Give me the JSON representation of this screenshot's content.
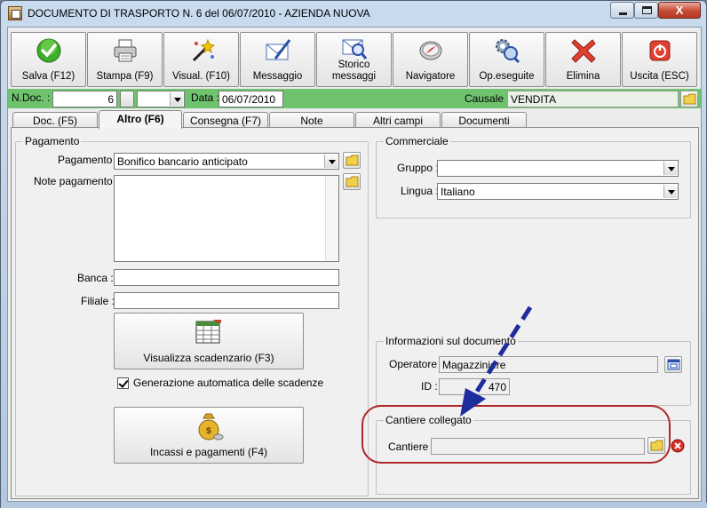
{
  "window": {
    "title": "DOCUMENTO DI TRASPORTO N. 6  del 06/07/2010 - AZIENDA NUOVA",
    "close_glyph": "X"
  },
  "toolbar": [
    {
      "label": "Salva (F12)",
      "icon": "check-icon"
    },
    {
      "label": "Stampa (F9)",
      "icon": "printer-icon"
    },
    {
      "label": "Visual. (F10)",
      "icon": "magic-wand-icon"
    },
    {
      "label": "Messaggio",
      "icon": "envelope-pen-icon"
    },
    {
      "label": "Storico messaggi",
      "icon": "message-history-icon"
    },
    {
      "label": "Navigatore",
      "icon": "compass-icon"
    },
    {
      "label": "Op.eseguite",
      "icon": "gears-search-icon"
    },
    {
      "label": "Elimina",
      "icon": "red-x-icon"
    },
    {
      "label": "Uscita (ESC)",
      "icon": "exit-icon"
    }
  ],
  "header": {
    "ndoc_label": "N.Doc. :",
    "ndoc_value": "6",
    "data_label": "Data :",
    "data_value": "06/07/2010",
    "causale_label": "Causale :",
    "causale_value": "VENDITA"
  },
  "tabs": [
    {
      "label": "Doc. (F5)",
      "active": false
    },
    {
      "label": "Altro (F6)",
      "active": true
    },
    {
      "label": "Consegna (F7)",
      "active": false
    },
    {
      "label": "Note",
      "active": false
    },
    {
      "label": "Altri campi",
      "active": false
    },
    {
      "label": "Documenti",
      "active": false
    }
  ],
  "pagamento": {
    "group_title": "Pagamento",
    "pagamento_label": "Pagamento :",
    "pagamento_value": "Bonifico bancario anticipato",
    "note_label": "Note pagamento :",
    "note_value": "",
    "banca_label": "Banca :",
    "banca_value": "",
    "filiale_label": "Filiale :",
    "filiale_value": "",
    "scadenzario_label": "Visualizza scadenzario (F3)",
    "auto_scadenze_label": "Generazione automatica delle scadenze",
    "auto_scadenze_checked": true,
    "incassi_label": "Incassi e pagamenti (F4)"
  },
  "commerciale": {
    "group_title": "Commerciale",
    "gruppo_label": "Gruppo :",
    "gruppo_value": "",
    "lingua_label": "Lingua :",
    "lingua_value": "Italiano"
  },
  "info_documento": {
    "group_title": "Informazioni sul documento",
    "operatore_label": "Operatore :",
    "operatore_value": "Magazziniere",
    "id_label": "ID :",
    "id_value": "470"
  },
  "cantiere": {
    "group_title": "Cantiere collegato",
    "cantiere_label": "Cantiere :",
    "cantiere_value": ""
  },
  "annotation": {
    "arrow_color": "#1f2c9e",
    "oval_color": "#b0262a"
  }
}
